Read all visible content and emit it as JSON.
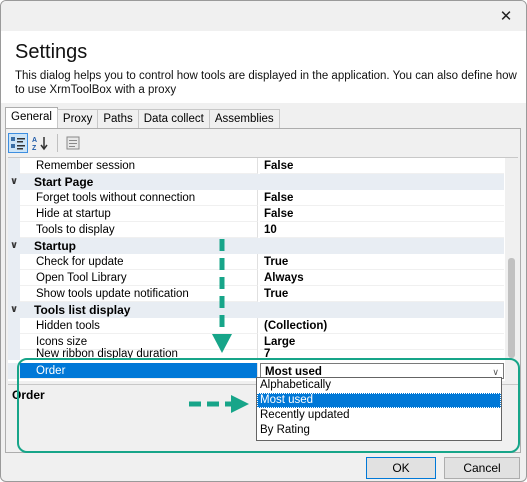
{
  "window": {
    "title": "Settings",
    "description": "This dialog helps you to control how tools are displayed in the application. You can also define how to use XrmToolBox with a proxy",
    "close_glyph": "✕"
  },
  "tabs": [
    "General",
    "Proxy",
    "Paths",
    "Data collect",
    "Assemblies"
  ],
  "toolbar": {
    "categorized_icon": "categorized-view-icon",
    "sort_icon": "sort-az-icon",
    "sort_label": "A↓Z",
    "pages_icon": "property-pages-icon"
  },
  "grid": {
    "remember_session": {
      "name": "Remember session",
      "value": "False"
    },
    "start_page": {
      "label": "Start Page",
      "forget_tools": {
        "name": "Forget tools without connection",
        "value": "False"
      },
      "hide_at_startup": {
        "name": "Hide at startup",
        "value": "False"
      },
      "tools_to_display": {
        "name": "Tools to display",
        "value": "10"
      }
    },
    "startup": {
      "label": "Startup",
      "check_for_update": {
        "name": "Check for update",
        "value": "True"
      },
      "open_tool_library": {
        "name": "Open Tool Library",
        "value": "Always"
      },
      "show_update_notification": {
        "name": "Show tools update notification",
        "value": "True"
      }
    },
    "tools_list_display": {
      "label": "Tools list display",
      "hidden_tools": {
        "name": "Hidden tools",
        "value": "(Collection)"
      },
      "icons_size": {
        "name": "Icons size",
        "value": "Large"
      },
      "ribbon_duration": {
        "name": "New ribbon display duration",
        "value": "7"
      },
      "order": {
        "name": "Order",
        "value": "Most used"
      }
    }
  },
  "dropdown": {
    "options": [
      "Alphabetically",
      "Most used",
      "Recently updated",
      "By Rating"
    ],
    "selected": "Most used"
  },
  "help": {
    "title": "Order"
  },
  "buttons": {
    "ok": "OK",
    "cancel": "Cancel"
  },
  "colors": {
    "highlight": "#17a589",
    "selection": "#0078d7",
    "arrow": "#17a589"
  }
}
